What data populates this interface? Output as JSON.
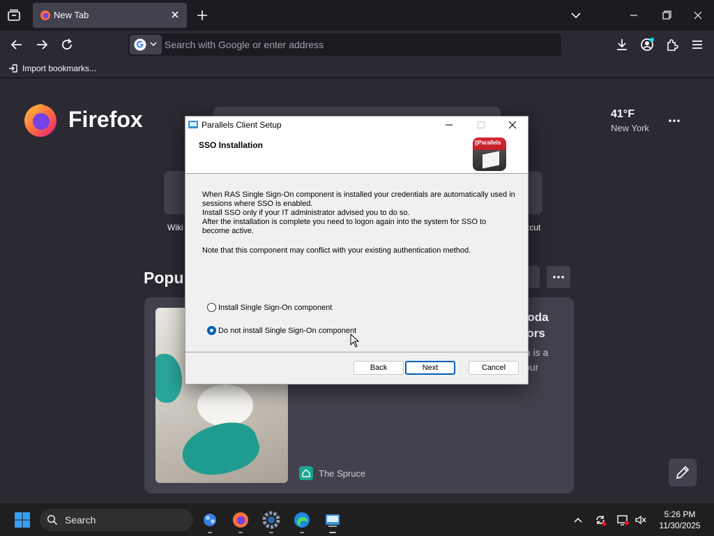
{
  "browser": {
    "tab_title": "New Tab",
    "url_placeholder": "Search with Google or enter address",
    "bookmark_item": "Import bookmarks..."
  },
  "newtab": {
    "brand": "Firefox",
    "weather_temp": "41°F",
    "weather_city": "New York",
    "shortcut_left_label": "Wiki",
    "shortcut_right_label": "rtcut",
    "popular_heading": "Popul",
    "card_headline_lines": [
      "Soda",
      "dors"
    ],
    "card_excerpt_lines": [
      "da is a",
      "your"
    ],
    "card_source": "The Spruce"
  },
  "dialog": {
    "window_title": "Parallels Client Setup",
    "heading": "SSO Installation",
    "logo_text": "||Parallels",
    "body_lines": [
      "When RAS Single Sign-On component is installed your credentials are automatically used in",
      "sessions where SSO is enabled.",
      "Install SSO only if your IT administrator advised you to do so.",
      "After the installation is complete you need to logon again into the system for SSO to",
      "become active."
    ],
    "note": "Note that this component may conflict with your existing authentication method.",
    "option_install": "Install Single Sign-On component",
    "option_no_install": "Do not install Single Sign-On component",
    "selected_option": "Do not install Single Sign-On component",
    "back_label": "Back",
    "next_label": "Next",
    "cancel_label": "Cancel"
  },
  "taskbar": {
    "search_label": "Search",
    "time": "5:26 PM",
    "date": "11/30/2025"
  },
  "colors": {
    "firefox_bg": "#2b2a33",
    "tabbar_bg": "#1c1b22",
    "accent_blue": "#005fb8",
    "parallels_red": "#d22a35"
  },
  "icons": {
    "navigation": [
      "back-icon",
      "forward-icon",
      "reload-icon"
    ],
    "toolbar_right": [
      "download-icon",
      "account-icon",
      "extensions-icon",
      "menu-icon"
    ],
    "taskbar_apps": [
      "widgets-app",
      "firefox-app",
      "settings-app",
      "edge-app",
      "parallels-setup-app"
    ],
    "tray": [
      "chevron-up-icon",
      "sync-icon",
      "display-icon",
      "network-sound-icon"
    ]
  }
}
